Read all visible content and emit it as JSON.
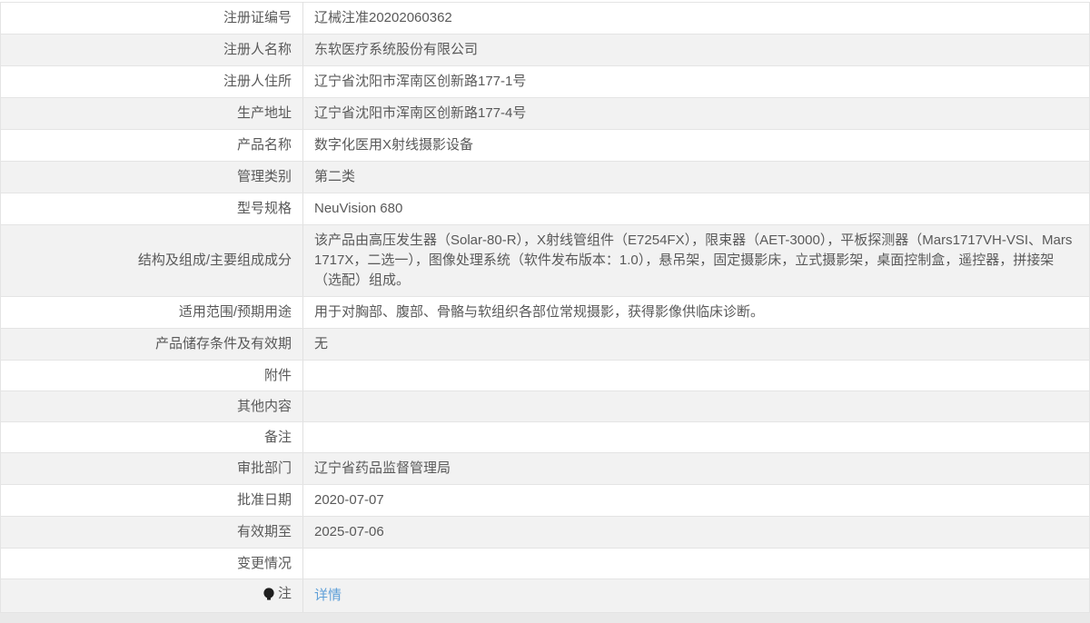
{
  "page": {
    "link_color": "#5e9fd8",
    "stripe_color": "#f2f2f2",
    "border_color": "#e4e4e4",
    "text_color": "#595959"
  },
  "table": {
    "rows": [
      {
        "label": "注册证编号",
        "value": "辽械注准20202060362"
      },
      {
        "label": "注册人名称",
        "value": "东软医疗系统股份有限公司"
      },
      {
        "label": "注册人住所",
        "value": "辽宁省沈阳市浑南区创新路177-1号"
      },
      {
        "label": "生产地址",
        "value": "辽宁省沈阳市浑南区创新路177-4号"
      },
      {
        "label": "产品名称",
        "value": "数字化医用X射线摄影设备"
      },
      {
        "label": "管理类别",
        "value": "第二类"
      },
      {
        "label": "型号规格",
        "value": "NeuVision 680"
      },
      {
        "label": "结构及组成/主要组成成分",
        "value": "该产品由高压发生器（Solar-80-R），X射线管组件（E7254FX），限束器（AET-3000），平板探测器（Mars1717VH-VSI、Mars1717X，二选一），图像处理系统（软件发布版本：1.0），悬吊架，固定摄影床，立式摄影架，桌面控制盒，遥控器，拼接架（选配）组成。"
      },
      {
        "label": "适用范围/预期用途",
        "value": "用于对胸部、腹部、骨骼与软组织各部位常规摄影，获得影像供临床诊断。"
      },
      {
        "label": "产品储存条件及有效期",
        "value": "无"
      },
      {
        "label": "附件",
        "value": ""
      },
      {
        "label": "其他内容",
        "value": ""
      },
      {
        "label": "备注",
        "value": ""
      },
      {
        "label": "审批部门",
        "value": "辽宁省药品监督管理局"
      },
      {
        "label": "批准日期",
        "value": "2020-07-07"
      },
      {
        "label": "有效期至",
        "value": "2025-07-06"
      },
      {
        "label": "变更情况",
        "value": ""
      },
      {
        "label": "注",
        "value": "详情",
        "link": true,
        "icon": "bulb-icon"
      }
    ]
  }
}
